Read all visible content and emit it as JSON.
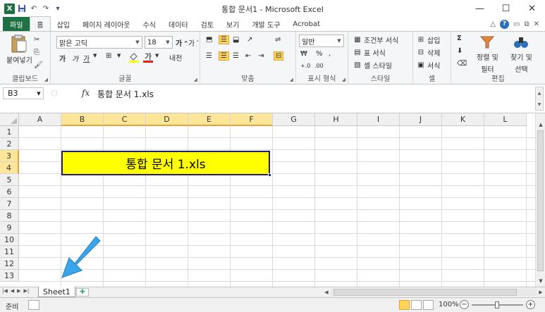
{
  "app": {
    "logo": "X",
    "title": "통합 문서1 - Microsoft Excel",
    "window_controls": [
      "—",
      "☐",
      "✕"
    ]
  },
  "tabs": [
    {
      "label": "파일"
    },
    {
      "label": "홈"
    },
    {
      "label": "삽입"
    },
    {
      "label": "페이지 레이아웃"
    },
    {
      "label": "수식"
    },
    {
      "label": "데이터"
    },
    {
      "label": "검토"
    },
    {
      "label": "보기"
    },
    {
      "label": "개발 도구"
    },
    {
      "label": "Acrobat"
    }
  ],
  "ribbon": {
    "clipboard": {
      "paste": "붙여넣기",
      "label": "클립보드"
    },
    "font": {
      "name": "맑은 고딕",
      "size": "18",
      "grow": "가",
      "shrink": "가",
      "bold": "가",
      "italic": "가",
      "underline": "가",
      "label": "글꼴",
      "ext": "내천"
    },
    "align": {
      "label": "맞춤"
    },
    "number": {
      "format": "일반",
      "label": "표시 형식"
    },
    "styles": {
      "cond": "조건부 서식",
      "table": "표 서식",
      "cell": "셀 스타일",
      "label": "스타일"
    },
    "cells": {
      "insert": "삽입",
      "delete": "삭제",
      "format": "서식",
      "label": "셀"
    },
    "edit": {
      "sigma": "Σ",
      "sort": "정렬 및",
      "sort2": "필터",
      "find": "찾기 및",
      "find2": "선택",
      "label": "편집"
    }
  },
  "formula_bar": {
    "name_box": "B3",
    "fx": "fx",
    "content": "통합 문서 1.xls"
  },
  "columns": [
    "A",
    "B",
    "C",
    "D",
    "E",
    "F",
    "G",
    "H",
    "I",
    "J",
    "K",
    "L"
  ],
  "rows": [
    "1",
    "2",
    "3",
    "4",
    "5",
    "6",
    "7",
    "8",
    "9",
    "10",
    "11",
    "12",
    "13"
  ],
  "merged_cell": {
    "text": "통합 문서 1.xls",
    "fill": "#ffff00"
  },
  "sheet": {
    "tab": "Sheet1"
  },
  "status": {
    "ready": "준비",
    "zoom": "100%"
  },
  "colors": {
    "accent": "#1e7145",
    "selection": "#fde59a",
    "arrow": "#3aa5e8"
  }
}
